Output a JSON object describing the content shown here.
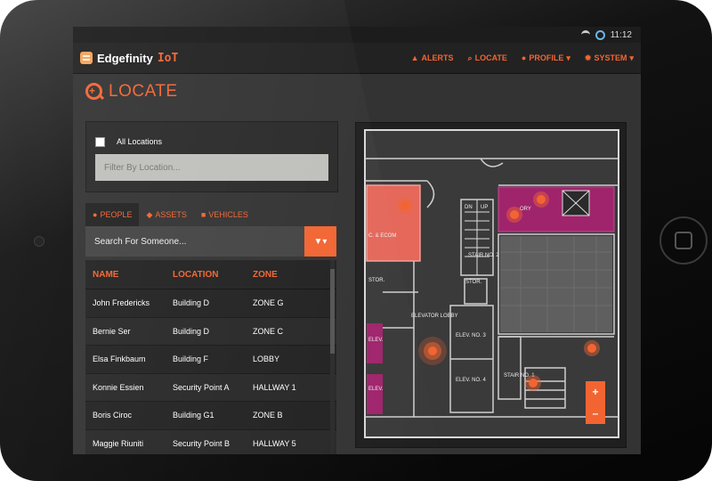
{
  "status_bar": {
    "time": "11:12"
  },
  "app": {
    "brand_name": "Edgefinity",
    "brand_suffix": "IoT"
  },
  "nav": {
    "items": [
      {
        "icon": "warning-icon",
        "label": "ALERTS"
      },
      {
        "icon": "search-icon",
        "label": "LOCATE"
      },
      {
        "icon": "user-icon",
        "label": "PROFILE"
      },
      {
        "icon": "gear-icon",
        "label": "SYSTEM"
      }
    ]
  },
  "page": {
    "title": "LOCATE"
  },
  "locations": {
    "all_label": "All Locations",
    "all_checked": false,
    "filter_placeholder": "Filter By Location..."
  },
  "tabs": [
    {
      "icon": "user-icon",
      "label": "PEOPLE",
      "active": true
    },
    {
      "icon": "cube-icon",
      "label": "ASSETS",
      "active": false
    },
    {
      "icon": "truck-icon",
      "label": "VEHICLES",
      "active": false
    }
  ],
  "search": {
    "placeholder": "Search For Someone..."
  },
  "table": {
    "headers": [
      "NAME",
      "LOCATION",
      "ZONE"
    ],
    "rows": [
      [
        "John Fredericks",
        "Building D",
        "ZONE G"
      ],
      [
        "Bernie Ser",
        "Building D",
        "ZONE C"
      ],
      [
        "Elsa Finkbaum",
        "Building F",
        "LOBBY"
      ],
      [
        "Konnie Essien",
        "Security Point A",
        "HALLWAY 1"
      ],
      [
        "Boris Ciroc",
        "Building G1",
        "ZONE B"
      ],
      [
        "Maggie Riuniti",
        "Security Point B",
        "HALLWAY 5"
      ]
    ]
  },
  "map": {
    "labels": [
      "ELEVATOR LOBBY",
      "STOR.",
      "STOR.",
      "STAIR NO. 2",
      "STAIR NO. 1",
      "ELEV. NO. 3",
      "ELEV. NO. 4",
      "ELEV.",
      "ELEV.",
      "DN",
      "UP",
      "ORY",
      "C. & ECOM"
    ],
    "highlight_colors": {
      "red_zone": "#e5685b",
      "magenta_zone": "#a0246c",
      "marker": "#f26532"
    }
  },
  "zoom": {
    "in_label": "+",
    "out_label": "–"
  }
}
